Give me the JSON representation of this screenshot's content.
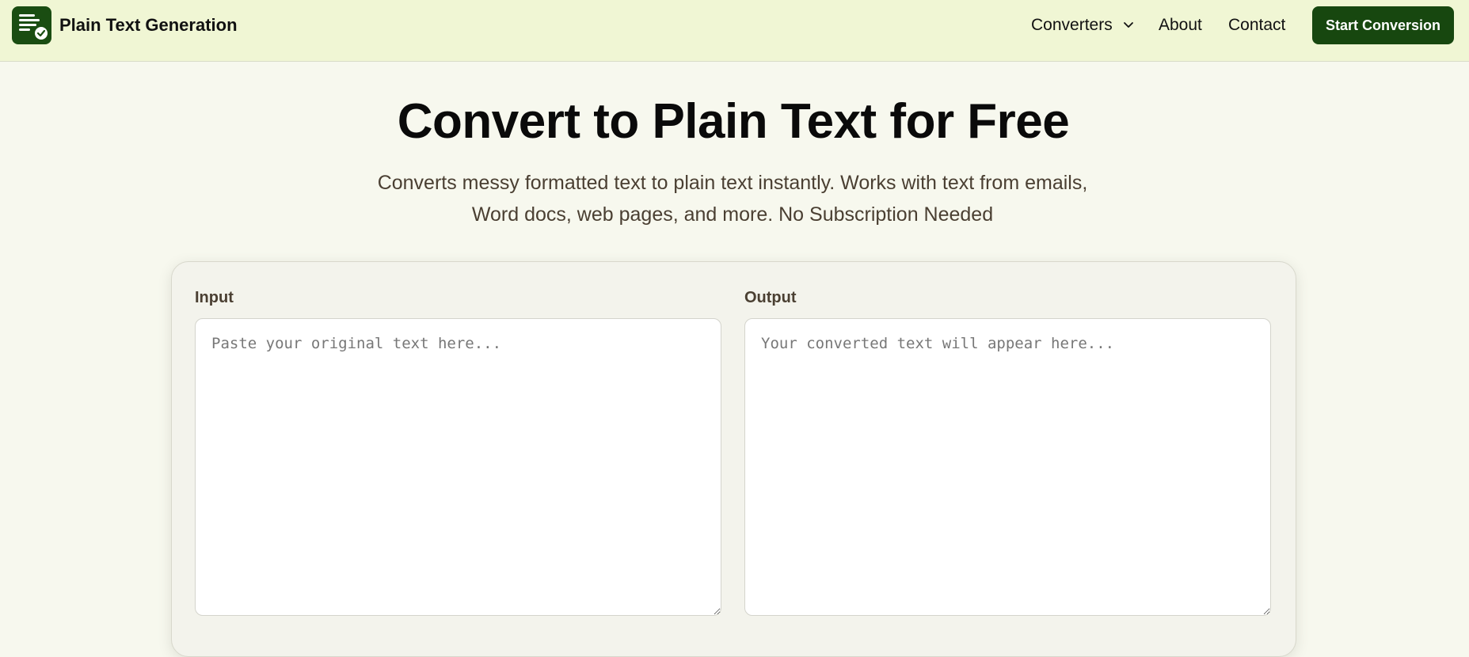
{
  "header": {
    "brand": "Plain Text Generation",
    "logo_icon": "document-check-icon",
    "nav": {
      "converters": "Converters",
      "about": "About",
      "contact": "Contact"
    },
    "cta": "Start Conversion"
  },
  "hero": {
    "title": "Convert to Plain Text for Free",
    "subtitle_line1": "Converts messy formatted text to plain text instantly. Works with text from emails,",
    "subtitle_line2": "Word docs, web pages, and more. No Subscription Needed"
  },
  "converter": {
    "input_label": "Input",
    "input_placeholder": "Paste your original text here...",
    "output_label": "Output",
    "output_placeholder": "Your converted text will appear here..."
  },
  "colors": {
    "brand_green": "#17470f",
    "header_bg": "#f0f6d4",
    "page_bg": "#f7f8ee"
  }
}
